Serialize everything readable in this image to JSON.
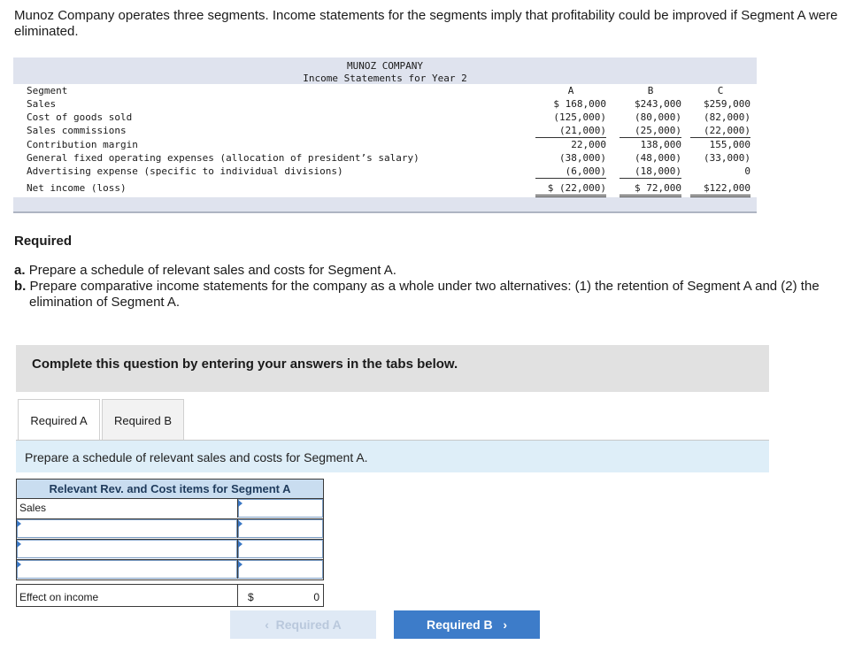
{
  "intro": "Munoz Company operates three segments. Income statements for the segments imply that profitability could be improved if Segment A were eliminated.",
  "statement": {
    "company": "MUNOZ COMPANY",
    "title": "Income Statements for Year 2",
    "rows": [
      {
        "label": "Segment",
        "a": "A",
        "b": "B",
        "c": "C"
      },
      {
        "label": "Sales",
        "a": "$ 168,000",
        "b": "$243,000",
        "c": "$259,000"
      },
      {
        "label": "Cost of goods sold",
        "a": "(125,000)",
        "b": "(80,000)",
        "c": "(82,000)"
      },
      {
        "label": "Sales commissions",
        "a": "(21,000)",
        "b": "(25,000)",
        "c": "(22,000)"
      },
      {
        "label": "Contribution margin",
        "a": "22,000",
        "b": "138,000",
        "c": "155,000"
      },
      {
        "label": "General fixed operating expenses (allocation of president’s salary)",
        "a": "(38,000)",
        "b": "(48,000)",
        "c": "(33,000)"
      },
      {
        "label": "Advertising expense (specific to individual divisions)",
        "a": "(6,000)",
        "b": "(18,000)",
        "c": "0"
      },
      {
        "label": "Net income (loss)",
        "a": "$ (22,000)",
        "b": "$ 72,000",
        "c": "$122,000"
      }
    ]
  },
  "required": {
    "title": "Required",
    "a_marker": "a.",
    "a_text": "Prepare a schedule of relevant sales and costs for Segment A.",
    "b_marker": "b.",
    "b_text": "Prepare comparative income statements for the company as a whole under two alternatives: (1) the retention of Segment A and (2) the elimination of Segment A."
  },
  "complete_banner": "Complete this question by entering your answers in the tabs below.",
  "tabs": [
    {
      "label": "Required A",
      "active": true
    },
    {
      "label": "Required B",
      "active": false
    }
  ],
  "instruction": "Prepare a schedule of relevant sales and costs for Segment A.",
  "answer_table": {
    "header": "Relevant Rev. and Cost items for Segment A",
    "rows": [
      {
        "label": "Sales",
        "value": ""
      },
      {
        "label": "",
        "value": ""
      },
      {
        "label": "",
        "value": ""
      },
      {
        "label": "",
        "value": ""
      }
    ],
    "total_label": "Effect on income",
    "total_currency": "$",
    "total_value": "0"
  },
  "nav": {
    "prev_label": "Required A",
    "next_label": "Required B",
    "prev_arrow": "‹",
    "next_arrow": "›"
  },
  "colors": {
    "accent": "#3d7cc9",
    "banner": "#e1e1e1",
    "instruction_bg": "#deeef8",
    "table_header": "#c9ddf0"
  }
}
